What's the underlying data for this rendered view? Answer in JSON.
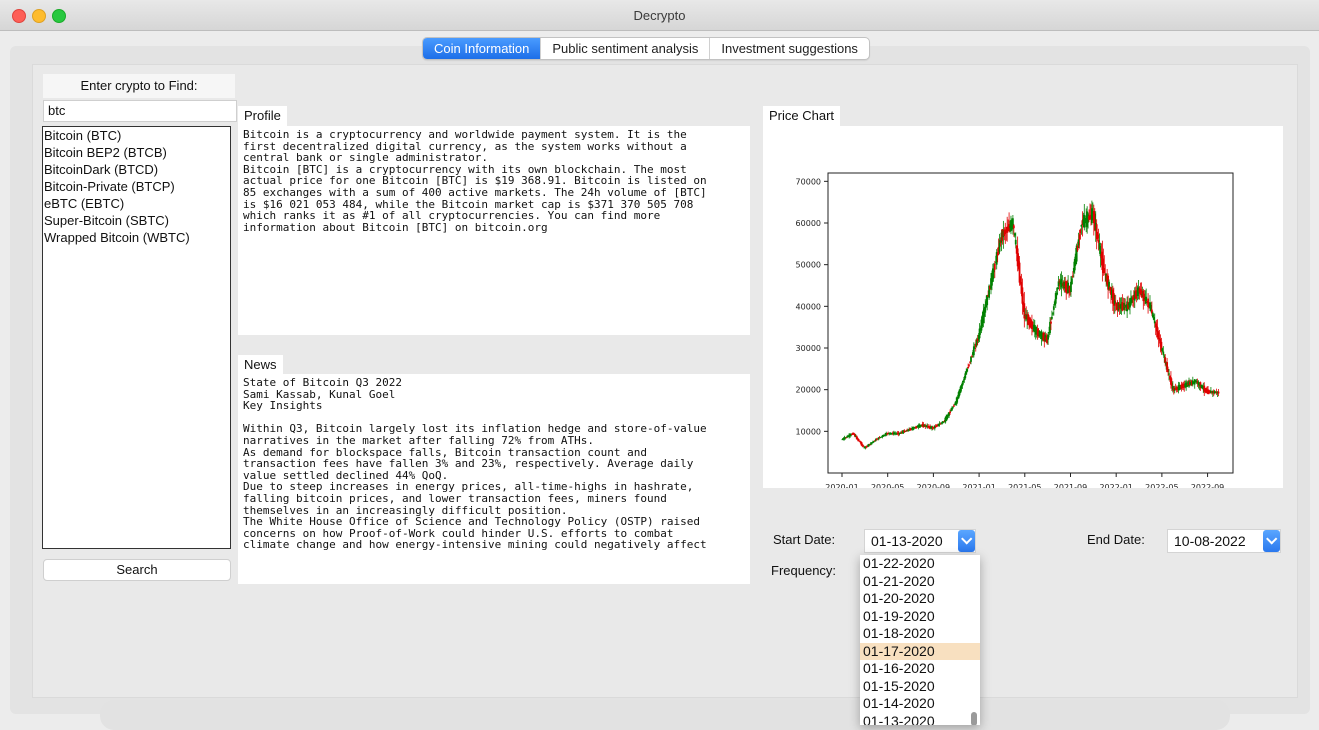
{
  "window": {
    "title": "Decrypto"
  },
  "tabs": [
    {
      "label": "Coin Information",
      "active": true
    },
    {
      "label": "Public sentiment analysis",
      "active": false
    },
    {
      "label": "Investment suggestions",
      "active": false
    }
  ],
  "search": {
    "label": "Enter crypto to Find:",
    "value": "btc",
    "results": [
      "Bitcoin (BTC)",
      "Bitcoin BEP2 (BTCB)",
      "BitcoinDark (BTCD)",
      "Bitcoin-Private (BTCP)",
      "eBTC (EBTC)",
      "Super-Bitcoin (SBTC)",
      "Wrapped Bitcoin (WBTC)"
    ],
    "button_label": "Search"
  },
  "profile": {
    "heading": "Profile",
    "text": "Bitcoin is a cryptocurrency and worldwide payment system. It is the\nfirst decentralized digital currency, as the system works without a\ncentral bank or single administrator.\nBitcoin [BTC] is a cryptocurrency with its own blockchain. The most\nactual price for one Bitcoin [BTC] is $19 368.91. Bitcoin is listed on\n85 exchanges with a sum of 400 active markets. The 24h volume of [BTC]\nis $16 021 053 484, while the Bitcoin market cap is $371 370 505 708\nwhich ranks it as #1 of all cryptocurrencies. You can find more\ninformation about Bitcoin [BTC] on bitcoin.org"
  },
  "news": {
    "heading": "News",
    "text": "State of Bitcoin Q3 2022\nSami Kassab, Kunal Goel\nKey Insights\n\nWithin Q3, Bitcoin largely lost its inflation hedge and store-of-value\nnarratives in the market after falling 72% from ATHs.\nAs demand for blockspace falls, Bitcoin transaction count and\ntransaction fees have fallen 3% and 23%, respectively. Average daily\nvalue settled declined 44% QoQ.\nDue to steep increases in energy prices, all-time-highs in hashrate,\nfalling bitcoin prices, and lower transaction fees, miners found\nthemselves in an increasingly difficult position.\nThe White House Office of Science and Technology Policy (OSTP) raised\nconcerns on how Proof-of-Work could hinder U.S. efforts to combat\nclimate change and how energy-intensive mining could negatively affect"
  },
  "chart": {
    "heading": "Price Chart",
    "up_color": "#008000",
    "down_color": "#e00000"
  },
  "chart_data": {
    "type": "line",
    "title": "",
    "xlabel": "",
    "ylabel": "",
    "x_tick_labels": [
      "2020-01",
      "2020-05",
      "2020-09",
      "2021-01",
      "2021-05",
      "2021-09",
      "2022-01",
      "2022-05",
      "2022-09"
    ],
    "y_tick_labels": [
      "10000",
      "20000",
      "30000",
      "40000",
      "50000",
      "60000",
      "70000"
    ],
    "ylim": [
      0,
      72000
    ],
    "grid": false,
    "series": [
      {
        "name": "",
        "x": [
          "2020-01",
          "2020-02",
          "2020-03",
          "2020-04",
          "2020-05",
          "2020-06",
          "2020-07",
          "2020-08",
          "2020-09",
          "2020-10",
          "2020-11",
          "2020-12",
          "2021-01",
          "2021-02",
          "2021-03",
          "2021-04",
          "2021-05",
          "2021-06",
          "2021-07",
          "2021-08",
          "2021-09",
          "2021-10",
          "2021-11",
          "2021-12",
          "2022-01",
          "2022-02",
          "2022-03",
          "2022-04",
          "2022-05",
          "2022-06",
          "2022-07",
          "2022-08",
          "2022-09",
          "2022-10"
        ],
        "y": [
          8000,
          9500,
          6000,
          8000,
          9500,
          9500,
          10500,
          11500,
          10800,
          12500,
          17000,
          25000,
          33000,
          45000,
          57000,
          60000,
          38000,
          34000,
          32000,
          46000,
          44000,
          60000,
          62000,
          48000,
          40000,
          40000,
          44000,
          40000,
          30000,
          20000,
          21000,
          22000,
          19500,
          19300
        ]
      }
    ]
  },
  "filters": {
    "start_label": "Start Date:",
    "start_value": "01-13-2020",
    "end_label": "End Date:",
    "end_value": "10-08-2022",
    "frequency_label": "Frequency:"
  },
  "date_dropdown": {
    "options": [
      "01-22-2020",
      "01-21-2020",
      "01-20-2020",
      "01-19-2020",
      "01-18-2020",
      "01-17-2020",
      "01-16-2020",
      "01-15-2020",
      "01-14-2020",
      "01-13-2020"
    ],
    "highlighted": "01-17-2020"
  }
}
